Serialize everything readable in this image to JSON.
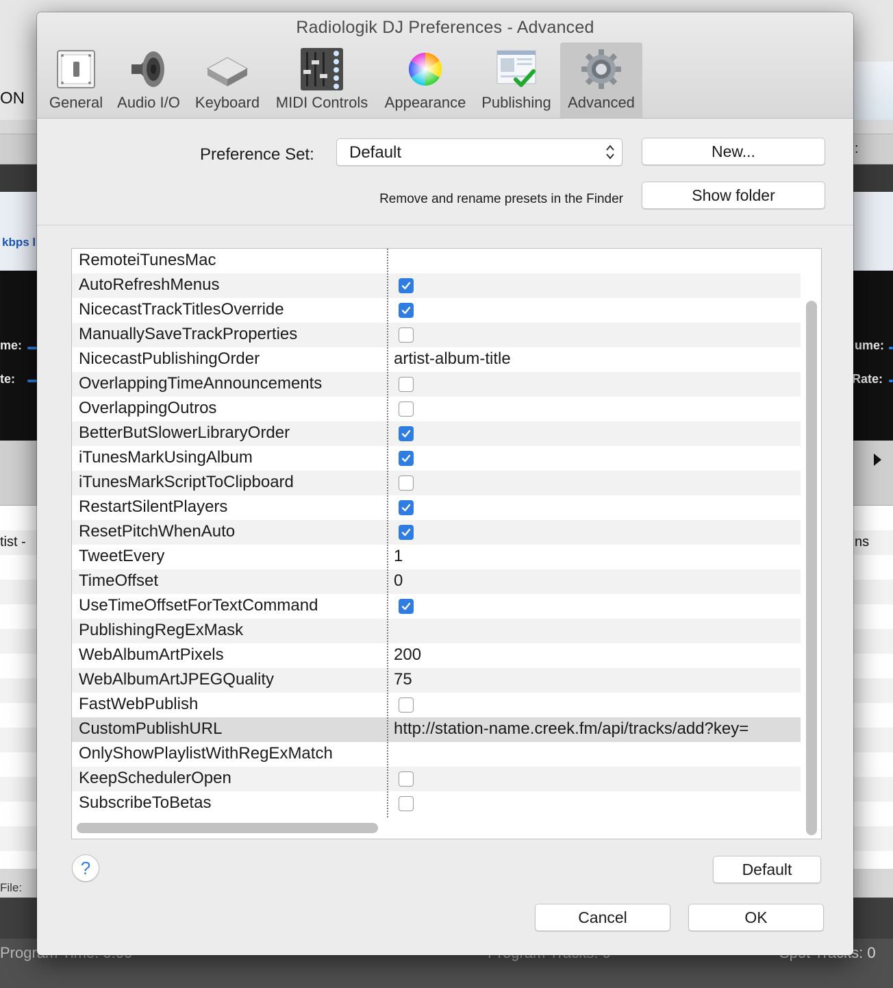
{
  "background_app": {
    "on_label": "ON",
    "kbps_label": "kbps l",
    "volume_left": "me:",
    "rate_left": "te:",
    "volume_right": "ume:",
    "rate_right": "Rate:",
    "artist_col": "tist -",
    "col_right": "ns",
    "colon_right": ":",
    "file_label": "File:",
    "program_time": "Program Time: 0:00",
    "program_tracks": "Program Tracks: 0",
    "spot_tracks": "Spot Tracks: 0"
  },
  "window": {
    "title": "Radiologik DJ Preferences - Advanced"
  },
  "toolbar": {
    "tabs": [
      {
        "label": "General",
        "icon": "switch-icon",
        "selected": false
      },
      {
        "label": "Audio I/O",
        "icon": "speaker-icon",
        "selected": false
      },
      {
        "label": "Keyboard",
        "icon": "key-icon",
        "selected": false
      },
      {
        "label": "MIDI Controls",
        "icon": "mixer-icon",
        "selected": false
      },
      {
        "label": "Appearance",
        "icon": "color-wheel-icon",
        "selected": false
      },
      {
        "label": "Publishing",
        "icon": "publish-check-icon",
        "selected": false
      },
      {
        "label": "Advanced",
        "icon": "gear-icon",
        "selected": true
      }
    ]
  },
  "preferences": {
    "set_label": "Preference Set:",
    "set_value": "Default",
    "new_button": "New...",
    "hint": "Remove and rename presets in the Finder",
    "show_folder_button": "Show folder"
  },
  "table": {
    "rows": [
      {
        "key": "RemoteiTunesMac",
        "type": "text",
        "value": ""
      },
      {
        "key": "AutoRefreshMenus",
        "type": "checkbox",
        "checked": true
      },
      {
        "key": "NicecastTrackTitlesOverride",
        "type": "checkbox",
        "checked": true
      },
      {
        "key": "ManuallySaveTrackProperties",
        "type": "checkbox",
        "checked": false
      },
      {
        "key": "NicecastPublishingOrder",
        "type": "text",
        "value": "artist-album-title"
      },
      {
        "key": "OverlappingTimeAnnouncements",
        "type": "checkbox",
        "checked": false
      },
      {
        "key": "OverlappingOutros",
        "type": "checkbox",
        "checked": false
      },
      {
        "key": "BetterButSlowerLibraryOrder",
        "type": "checkbox",
        "checked": true
      },
      {
        "key": "iTunesMarkUsingAlbum",
        "type": "checkbox",
        "checked": true
      },
      {
        "key": "iTunesMarkScriptToClipboard",
        "type": "checkbox",
        "checked": false
      },
      {
        "key": "RestartSilentPlayers",
        "type": "checkbox",
        "checked": true
      },
      {
        "key": "ResetPitchWhenAuto",
        "type": "checkbox",
        "checked": true
      },
      {
        "key": "TweetEvery",
        "type": "text",
        "value": "1"
      },
      {
        "key": "TimeOffset",
        "type": "text",
        "value": "0"
      },
      {
        "key": "UseTimeOffsetForTextCommand",
        "type": "checkbox",
        "checked": true
      },
      {
        "key": "PublishingRegExMask",
        "type": "text",
        "value": ""
      },
      {
        "key": "WebAlbumArtPixels",
        "type": "text",
        "value": "200"
      },
      {
        "key": "WebAlbumArtJPEGQuality",
        "type": "text",
        "value": "75"
      },
      {
        "key": "FastWebPublish",
        "type": "checkbox",
        "checked": false
      },
      {
        "key": "CustomPublishURL",
        "type": "text",
        "value": "http://station-name.creek.fm/api/tracks/add?key=",
        "selected": true
      },
      {
        "key": "OnlyShowPlaylistWithRegExMatch",
        "type": "text",
        "value": ""
      },
      {
        "key": "KeepSchedulerOpen",
        "type": "checkbox",
        "checked": false
      },
      {
        "key": "SubscribeToBetas",
        "type": "checkbox",
        "checked": false
      }
    ]
  },
  "footer": {
    "help_label": "?",
    "default_button": "Default",
    "cancel_button": "Cancel",
    "ok_button": "OK"
  },
  "colors": {
    "accent": "#2f7de1",
    "window_bg": "#ececec",
    "selected_tab": "#c7c7c7"
  }
}
